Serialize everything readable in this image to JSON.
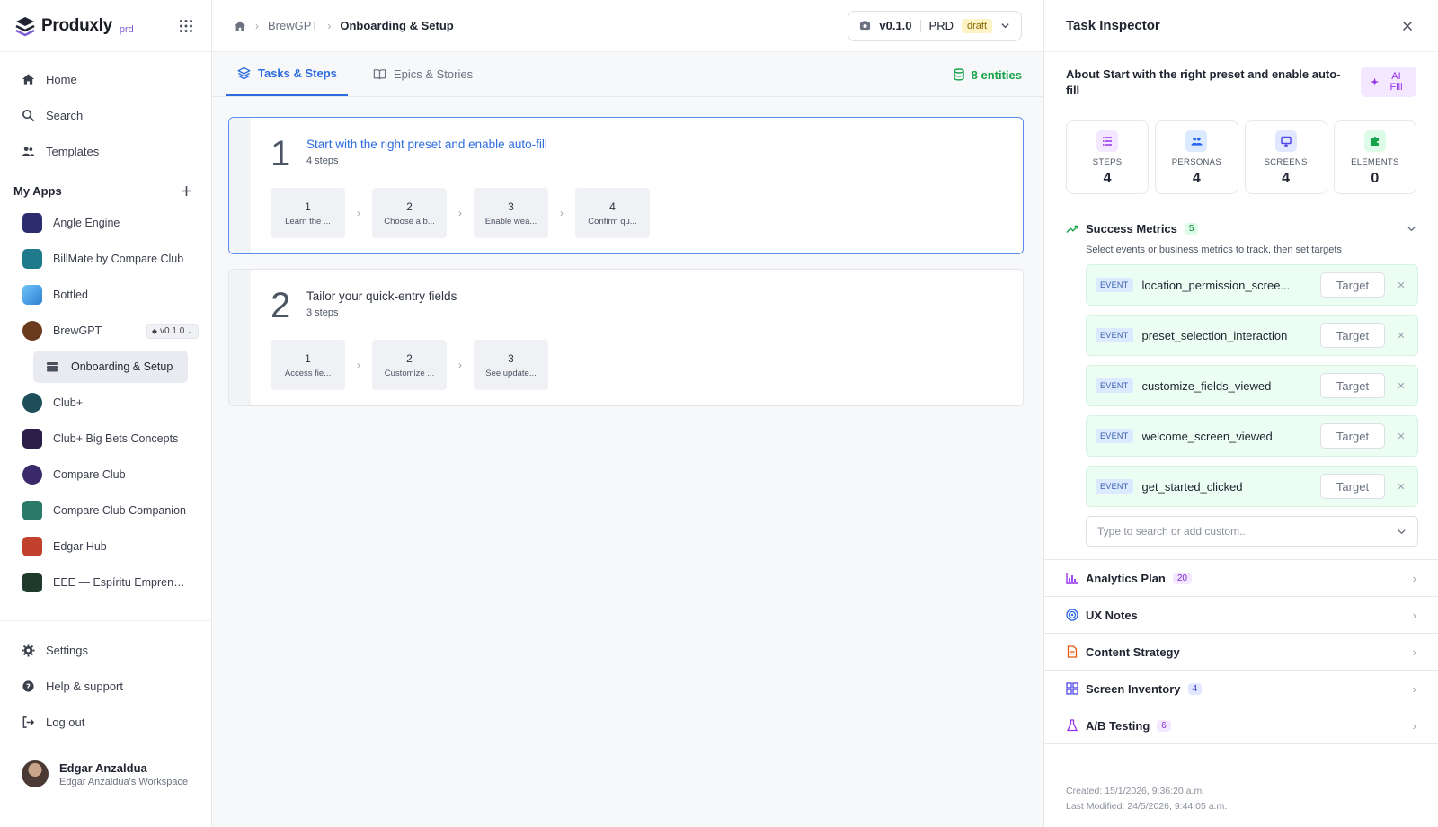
{
  "brand": {
    "name": "Produxly",
    "sub": "prd"
  },
  "nav": {
    "home": "Home",
    "search": "Search",
    "templates": "Templates"
  },
  "myapps": {
    "title": "My Apps",
    "apps": [
      {
        "label": "Angle Engine",
        "color": "#2b2d6e"
      },
      {
        "label": "BillMate by Compare Club",
        "color": "#1f7a8c"
      },
      {
        "label": "Bottled",
        "color": "#3a9ad9"
      },
      {
        "label": "BrewGPT",
        "color": "#6b3a1e",
        "version": "v0.1.0"
      },
      {
        "label": "Club+",
        "color": "#1e4e5a"
      },
      {
        "label": "Club+ Big Bets Concepts",
        "color": "#2a1d4a"
      },
      {
        "label": "Compare Club",
        "color": "#3b2a6b"
      },
      {
        "label": "Compare Club Companion",
        "color": "#2a7a6a"
      },
      {
        "label": "Edgar Hub",
        "color": "#c2412d"
      },
      {
        "label": "EEE — Espíritu Emprende...",
        "color": "#1d3a2a"
      }
    ],
    "active_sub": "Onboarding & Setup"
  },
  "bottom_nav": {
    "settings": "Settings",
    "help": "Help & support",
    "logout": "Log out"
  },
  "user": {
    "name": "Edgar Anzaldua",
    "workspace": "Edgar Anzaldua's Workspace"
  },
  "breadcrumb": {
    "parent": "BrewGPT",
    "current": "Onboarding & Setup"
  },
  "version": {
    "number": "v0.1.0",
    "doc": "PRD",
    "status": "draft"
  },
  "tabs": [
    {
      "label": "Tasks & Steps"
    },
    {
      "label": "Epics & Stories"
    }
  ],
  "entities": "8 entities",
  "tasks": [
    {
      "num": "1",
      "title": "Start with the right preset and enable auto-fill",
      "steps_count": "4 steps",
      "steps": [
        {
          "n": "1",
          "t": "Learn the ..."
        },
        {
          "n": "2",
          "t": "Choose a b..."
        },
        {
          "n": "3",
          "t": "Enable wea..."
        },
        {
          "n": "4",
          "t": "Confirm qu..."
        }
      ]
    },
    {
      "num": "2",
      "title": "Tailor your quick-entry fields",
      "steps_count": "3 steps",
      "steps": [
        {
          "n": "1",
          "t": "Access fie..."
        },
        {
          "n": "2",
          "t": "Customize ..."
        },
        {
          "n": "3",
          "t": "See update..."
        }
      ]
    }
  ],
  "inspector": {
    "title": "Task Inspector",
    "about": "About Start with the right preset and enable auto-fill",
    "ai_fill": "AI Fill",
    "stats": [
      {
        "label": "STEPS",
        "value": "4"
      },
      {
        "label": "PERSONAS",
        "value": "4"
      },
      {
        "label": "SCREENS",
        "value": "4"
      },
      {
        "label": "ELEMENTS",
        "value": "0"
      }
    ],
    "metrics": {
      "title": "Success Metrics",
      "count": "5",
      "hint": "Select events or business metrics to track, then set targets",
      "tag": "EVENT",
      "target_label": "Target",
      "events": [
        "location_permission_scree...",
        "preset_selection_interaction",
        "customize_fields_viewed",
        "welcome_screen_viewed",
        "get_started_clicked"
      ],
      "placeholder": "Type to search or add custom..."
    },
    "sections": [
      {
        "label": "Analytics Plan",
        "count": "20"
      },
      {
        "label": "UX Notes",
        "count": ""
      },
      {
        "label": "Content Strategy",
        "count": ""
      },
      {
        "label": "Screen Inventory",
        "count": "4"
      },
      {
        "label": "A/B Testing",
        "count": "6"
      }
    ],
    "created": "Created: 15/1/2026, 9:36:20 a.m.",
    "modified": "Last Modified: 24/5/2026, 9:44:05 a.m."
  }
}
